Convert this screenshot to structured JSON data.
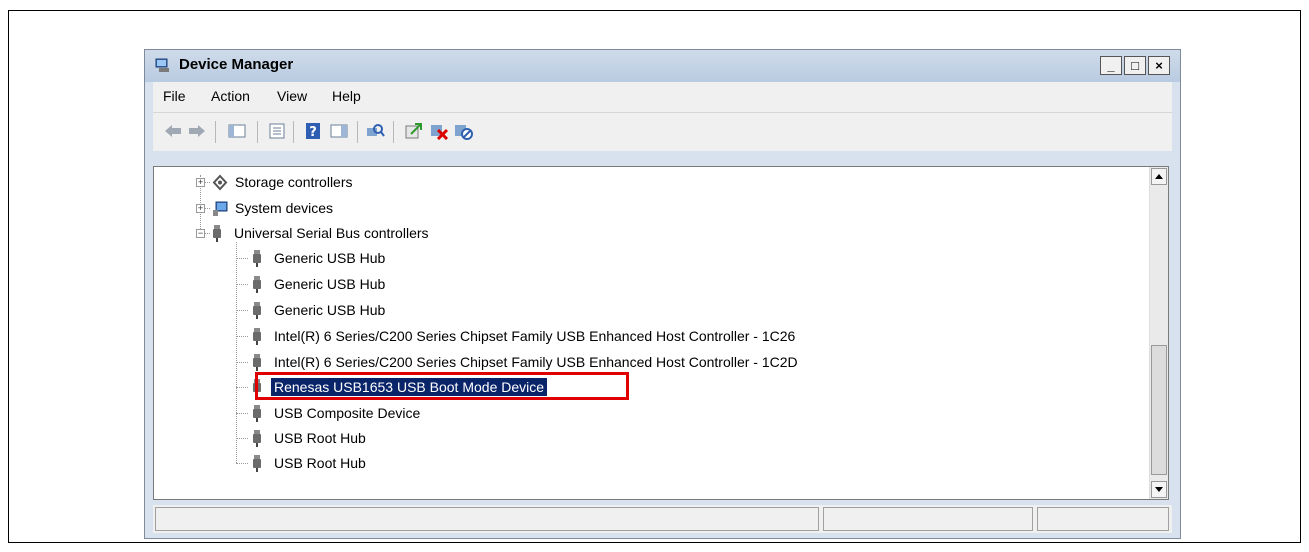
{
  "window": {
    "title": "Device Manager",
    "minimize_label": "_",
    "maximize_label": "□",
    "close_label": "×"
  },
  "menu": {
    "items": [
      {
        "label": "File"
      },
      {
        "label": "Action"
      },
      {
        "label": "View"
      },
      {
        "label": "Help"
      }
    ]
  },
  "toolbar": {
    "buttons": [
      {
        "icon": "back-arrow-icon"
      },
      {
        "icon": "forward-arrow-icon"
      },
      {
        "icon": "show-hide-console-tree-icon"
      },
      {
        "icon": "properties-icon"
      },
      {
        "icon": "help-icon"
      },
      {
        "icon": "show-action-pane-icon"
      },
      {
        "icon": "scan-hardware-changes-icon"
      },
      {
        "icon": "update-driver-icon"
      },
      {
        "icon": "uninstall-icon"
      },
      {
        "icon": "disable-device-icon"
      }
    ]
  },
  "tree": {
    "categories": [
      {
        "label": "Storage controllers",
        "icon": "storage-controller-icon",
        "expanded": false
      },
      {
        "label": "System devices",
        "icon": "system-devices-icon",
        "expanded": false
      },
      {
        "label": "Universal Serial Bus controllers",
        "icon": "usb-icon",
        "expanded": true
      }
    ],
    "usb_children": [
      {
        "label": "Generic USB Hub"
      },
      {
        "label": "Generic USB Hub"
      },
      {
        "label": "Generic USB Hub"
      },
      {
        "label": "Intel(R) 6 Series/C200 Series Chipset Family USB Enhanced Host Controller - 1C26"
      },
      {
        "label": "Intel(R) 6 Series/C200 Series Chipset Family USB Enhanced Host Controller - 1C2D"
      },
      {
        "label": "Renesas USB1653 USB Boot Mode Device",
        "selected": true
      },
      {
        "label": "USB Composite Device"
      },
      {
        "label": "USB Root Hub"
      },
      {
        "label": "USB Root Hub"
      }
    ]
  },
  "colors": {
    "selection_bg": "#0a246a",
    "highlight_box": "#e00000"
  }
}
